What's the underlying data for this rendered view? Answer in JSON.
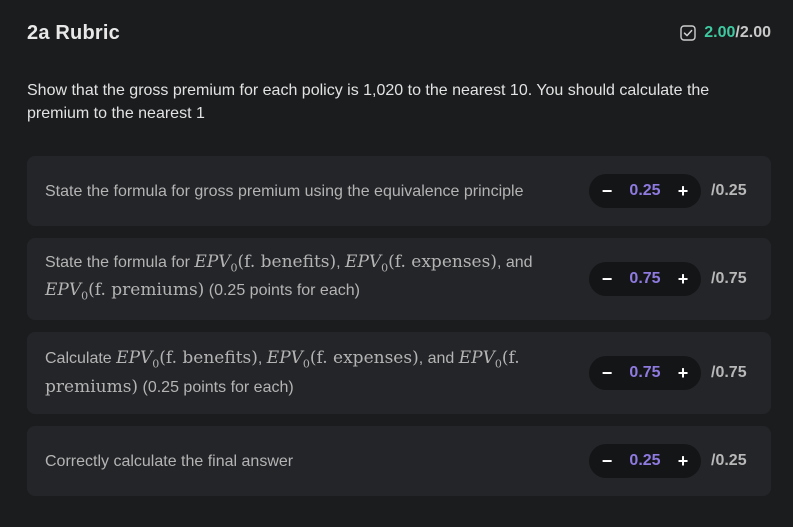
{
  "rubric": {
    "title": "2a Rubric",
    "score_earned": "2.00",
    "score_total": "/2.00",
    "prompt": "Show that the gross premium for each policy is 1,020 to the nearest 10. You should calculate the premium to the nearest 1"
  },
  "criteria": [
    {
      "text": "State the formula for gross premium using the equivalence principle",
      "value": "0.25",
      "max": "/0.25"
    },
    {
      "pre": "State the formula for ",
      "m1": "EPV",
      "m1_sub": "0",
      "m1_arg": "(f. benefits)",
      "sep1": ", ",
      "m2": "EPV",
      "m2_sub": "0",
      "m2_arg": "(f. expenses)",
      "sep2": ", and ",
      "m3": "EPV",
      "m3_sub": "0",
      "m3_arg": "(f. premiums)",
      "post": " (0.25 points for each)",
      "value": "0.75",
      "max": "/0.75"
    },
    {
      "pre": "Calculate ",
      "m1": "EPV",
      "m1_sub": "0",
      "m1_arg": "(f. benefits)",
      "sep1": ", ",
      "m2": "EPV",
      "m2_sub": "0",
      "m2_arg": "(f. expenses)",
      "sep2": ", and ",
      "m3": "EPV",
      "m3_sub": "0",
      "m3_arg": "(f. premiums)",
      "post": " (0.25 points for each)",
      "value": "0.75",
      "max": "/0.75"
    },
    {
      "text": "Correctly calculate the final answer",
      "value": "0.25",
      "max": "/0.25"
    }
  ],
  "controls": {
    "minus": "−",
    "plus": "+"
  },
  "colors": {
    "background": "#1b1c1e",
    "card": "#242528",
    "score_accent": "#3ec9a1",
    "value_accent": "#8f7be0"
  },
  "icons": {
    "score": "checkbox-check-icon"
  }
}
